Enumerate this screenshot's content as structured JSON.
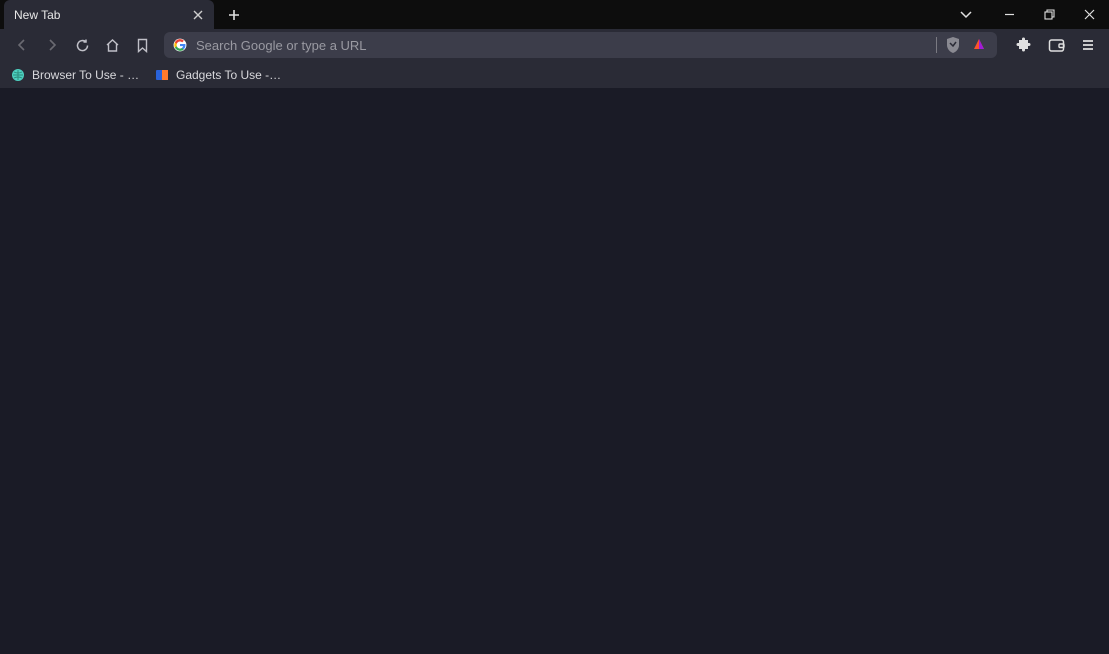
{
  "tab": {
    "title": "New Tab"
  },
  "omnibox": {
    "placeholder": "Search Google or type a URL",
    "value": ""
  },
  "bookmarks": [
    {
      "label": "Browser To Use - Br...",
      "favicon_color1": "#4dd0c0",
      "favicon_color2": "#2a8a7a"
    },
    {
      "label": "Gadgets To Use - N...",
      "favicon_color1": "#2962d9",
      "favicon_color2": "#ff7a2d"
    }
  ],
  "colors": {
    "brave_orange": "#fb542b",
    "brave_purple": "#a01bd8"
  }
}
